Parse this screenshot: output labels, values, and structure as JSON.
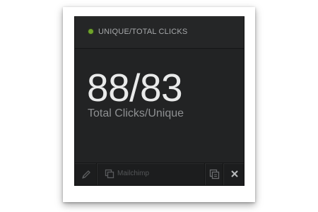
{
  "widget": {
    "title": "UNIQUE/TOTAL CLICKS",
    "status_color": "#6fa42a",
    "value": "88/83",
    "caption": "Total Clicks/Unique"
  },
  "footer": {
    "source_label": "Mailchimp",
    "icons": [
      "pencil-icon",
      "duplicate-icon",
      "copy-icon",
      "close-icon"
    ]
  }
}
